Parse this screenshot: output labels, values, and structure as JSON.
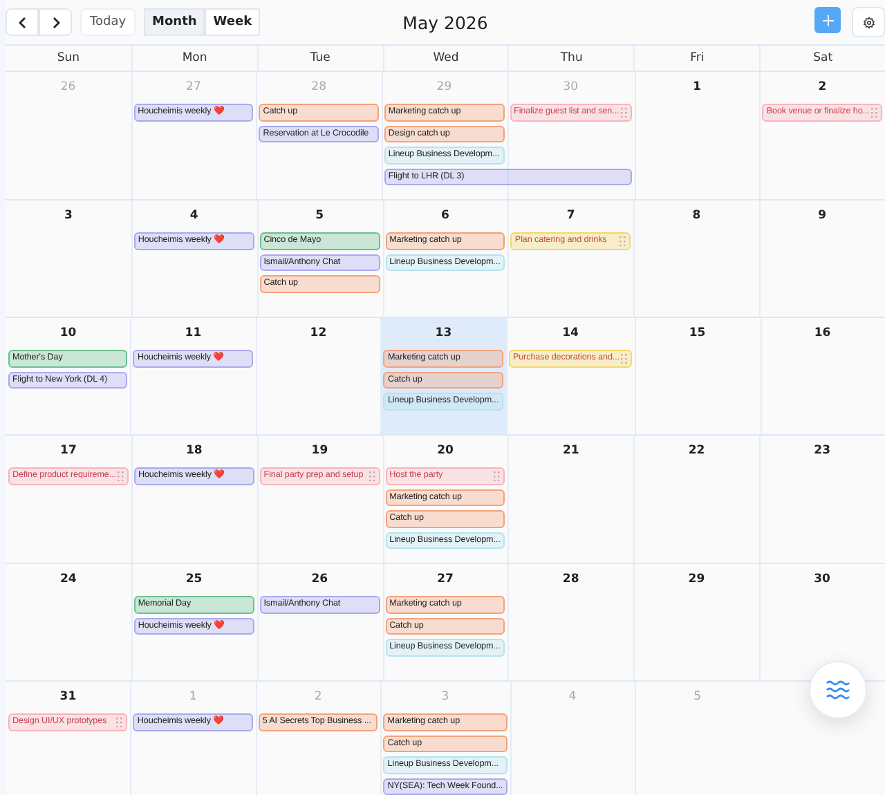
{
  "toolbar": {
    "today": "Today",
    "views": [
      {
        "label": "Month",
        "selected": true
      },
      {
        "label": "Week",
        "selected": false
      }
    ],
    "title": "May 2026"
  },
  "weekdays": [
    "Sun",
    "Mon",
    "Tue",
    "Wed",
    "Thu",
    "Fri",
    "Sat"
  ],
  "weeks": [
    {
      "days": [
        {
          "label": "26",
          "muted": true,
          "today": false
        },
        {
          "label": "27",
          "muted": true,
          "today": false,
          "events": [
            {
              "title": "Houcheimis weekly ❤️",
              "color": "#a9a9f0",
              "kind": "event"
            }
          ]
        },
        {
          "label": "28",
          "muted": true,
          "today": false,
          "events": [
            {
              "title": "Catch up",
              "color": "#f4a27a",
              "kind": "event"
            },
            {
              "title": "Reservation at Le Crocodile",
              "color": "#a9a9f0",
              "kind": "event"
            }
          ]
        },
        {
          "label": "29",
          "muted": true,
          "today": false,
          "events": [
            {
              "title": "Marketing catch up",
              "color": "#f4a27a",
              "kind": "event"
            },
            {
              "title": "Design catch up",
              "color": "#f4a27a",
              "kind": "event"
            },
            {
              "title": "Lineup Business Developm...",
              "color": "#b5e3ef",
              "kind": "event"
            },
            {
              "title": "Flight to LHR (DL 3)",
              "color": "#a9a9f0",
              "kind": "event",
              "multi_day": true
            }
          ]
        },
        {
          "label": "30",
          "muted": true,
          "today": false,
          "events": [
            {
              "title": "Finalize guest list and sen...",
              "color": "#f9b3ba",
              "kind": "task"
            }
          ]
        },
        {
          "label": "1",
          "muted": false,
          "today": false
        },
        {
          "label": "2",
          "muted": false,
          "today": false,
          "events": [
            {
              "title": "Book venue or finalize ho...",
              "color": "#f9b3ba",
              "kind": "task"
            }
          ]
        }
      ]
    },
    {
      "days": [
        {
          "label": "3",
          "muted": false,
          "today": false
        },
        {
          "label": "4",
          "muted": false,
          "today": false,
          "events": [
            {
              "title": "Houcheimis weekly ❤️",
              "color": "#a9a9f0",
              "kind": "event"
            }
          ]
        },
        {
          "label": "5",
          "muted": false,
          "today": false,
          "events": [
            {
              "title": "Cinco de Mayo",
              "color": "#6cc08f",
              "kind": "event"
            },
            {
              "title": "Ismail/Anthony Chat",
              "color": "#a9a9f0",
              "kind": "event"
            },
            {
              "title": "Catch up",
              "color": "#f4a27a",
              "kind": "event"
            }
          ]
        },
        {
          "label": "6",
          "muted": false,
          "today": false,
          "events": [
            {
              "title": "Marketing catch up",
              "color": "#f4a27a",
              "kind": "event"
            },
            {
              "title": "Lineup Business Developm...",
              "color": "#b5e3ef",
              "kind": "event"
            }
          ]
        },
        {
          "label": "7",
          "muted": false,
          "today": false,
          "events": [
            {
              "title": "Plan catering and drinks",
              "color": "#f2d96a",
              "kind": "task"
            }
          ]
        },
        {
          "label": "8",
          "muted": false,
          "today": false
        },
        {
          "label": "9",
          "muted": false,
          "today": false
        }
      ]
    },
    {
      "days": [
        {
          "label": "10",
          "muted": false,
          "today": false,
          "events": [
            {
              "title": "Mother's Day",
              "color": "#6cc08f",
              "kind": "event"
            },
            {
              "title": "Flight to New York (DL 4)",
              "color": "#a9a9f0",
              "kind": "event"
            }
          ]
        },
        {
          "label": "11",
          "muted": false,
          "today": false,
          "events": [
            {
              "title": "Houcheimis weekly ❤️",
              "color": "#a9a9f0",
              "kind": "event"
            }
          ]
        },
        {
          "label": "12",
          "muted": false,
          "today": false
        },
        {
          "label": "13",
          "muted": false,
          "today": true,
          "events": [
            {
              "title": "Marketing catch up",
              "color": "#f4a27a",
              "kind": "event"
            },
            {
              "title": "Catch up",
              "color": "#f4a27a",
              "kind": "event"
            },
            {
              "title": "Lineup Business Developm...",
              "color": "#b5e3ef",
              "kind": "event"
            }
          ]
        },
        {
          "label": "14",
          "muted": false,
          "today": false,
          "events": [
            {
              "title": "Purchase decorations and...",
              "color": "#f2d96a",
              "kind": "task"
            }
          ]
        },
        {
          "label": "15",
          "muted": false,
          "today": false
        },
        {
          "label": "16",
          "muted": false,
          "today": false
        }
      ]
    },
    {
      "days": [
        {
          "label": "17",
          "muted": false,
          "today": false,
          "events": [
            {
              "title": "Define product requireme...",
              "color": "#f9b3ba",
              "kind": "task"
            }
          ]
        },
        {
          "label": "18",
          "muted": false,
          "today": false,
          "events": [
            {
              "title": "Houcheimis weekly ❤️",
              "color": "#a9a9f0",
              "kind": "event"
            }
          ]
        },
        {
          "label": "19",
          "muted": false,
          "today": false,
          "events": [
            {
              "title": "Final party prep and setup",
              "color": "#f9b3ba",
              "kind": "task"
            }
          ]
        },
        {
          "label": "20",
          "muted": false,
          "today": false,
          "events": [
            {
              "title": "Host the party",
              "color": "#f9b3ba",
              "kind": "task"
            },
            {
              "title": "Marketing catch up",
              "color": "#f4a27a",
              "kind": "event"
            },
            {
              "title": "Catch up",
              "color": "#f4a27a",
              "kind": "event"
            },
            {
              "title": "Lineup Business Developm...",
              "color": "#b5e3ef",
              "kind": "event"
            }
          ]
        },
        {
          "label": "21",
          "muted": false,
          "today": false
        },
        {
          "label": "22",
          "muted": false,
          "today": false
        },
        {
          "label": "23",
          "muted": false,
          "today": false
        }
      ]
    },
    {
      "days": [
        {
          "label": "24",
          "muted": false,
          "today": false
        },
        {
          "label": "25",
          "muted": false,
          "today": false,
          "events": [
            {
              "title": "Memorial Day",
              "color": "#6cc08f",
              "kind": "event"
            },
            {
              "title": "Houcheimis weekly ❤️",
              "color": "#a9a9f0",
              "kind": "event"
            }
          ]
        },
        {
          "label": "26",
          "muted": false,
          "today": false,
          "events": [
            {
              "title": "Ismail/Anthony Chat",
              "color": "#a9a9f0",
              "kind": "event"
            }
          ]
        },
        {
          "label": "27",
          "muted": false,
          "today": false,
          "events": [
            {
              "title": "Marketing catch up",
              "color": "#f4a27a",
              "kind": "event"
            },
            {
              "title": "Catch up",
              "color": "#f4a27a",
              "kind": "event"
            },
            {
              "title": "Lineup Business Developm...",
              "color": "#b5e3ef",
              "kind": "event"
            }
          ]
        },
        {
          "label": "28",
          "muted": false,
          "today": false
        },
        {
          "label": "29",
          "muted": false,
          "today": false
        },
        {
          "label": "30",
          "muted": false,
          "today": false
        }
      ]
    },
    {
      "days": [
        {
          "label": "31",
          "muted": false,
          "today": false,
          "events": [
            {
              "title": "Design UI/UX prototypes",
              "color": "#f9b3ba",
              "kind": "task"
            }
          ]
        },
        {
          "label": "1",
          "muted": true,
          "today": false,
          "events": [
            {
              "title": "Houcheimis weekly ❤️",
              "color": "#a9a9f0",
              "kind": "event"
            }
          ]
        },
        {
          "label": "2",
          "muted": true,
          "today": false,
          "events": [
            {
              "title": "5 AI Secrets Top Business ...",
              "color": "#f4a27a",
              "kind": "event"
            }
          ]
        },
        {
          "label": "3",
          "muted": true,
          "today": false,
          "events": [
            {
              "title": "Marketing catch up",
              "color": "#f4a27a",
              "kind": "event"
            },
            {
              "title": "Catch up",
              "color": "#f4a27a",
              "kind": "event"
            },
            {
              "title": "Lineup Business Developm...",
              "color": "#b5e3ef",
              "kind": "event"
            },
            {
              "title": "NY(SEA): Tech Week Found...",
              "color": "#a9a9f0",
              "kind": "event"
            }
          ]
        },
        {
          "label": "4",
          "muted": true,
          "today": false
        },
        {
          "label": "5",
          "muted": true,
          "today": false
        }
      ]
    }
  ]
}
